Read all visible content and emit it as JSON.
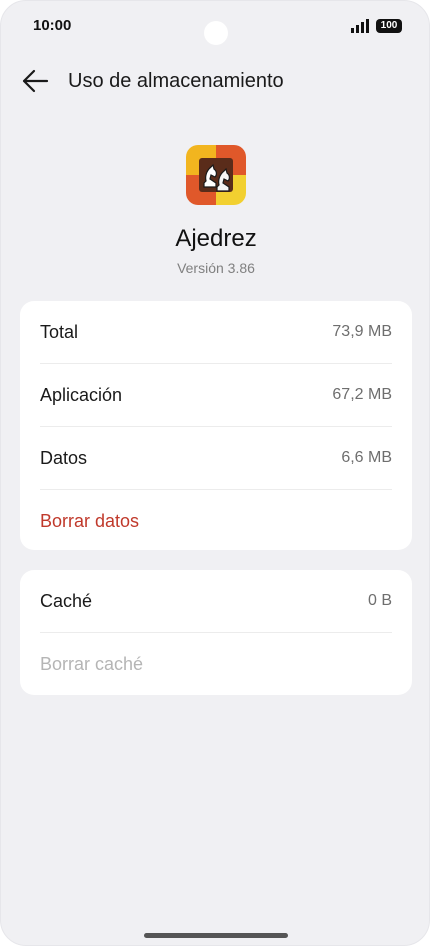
{
  "status_bar": {
    "time": "10:00",
    "battery": "100"
  },
  "header": {
    "title": "Uso de almacenamiento"
  },
  "app": {
    "name": "Ajedrez",
    "version": "Versión 3.86"
  },
  "storage": {
    "rows": [
      {
        "label": "Total",
        "value": "73,9 MB"
      },
      {
        "label": "Aplicación",
        "value": "67,2 MB"
      },
      {
        "label": "Datos",
        "value": "6,6 MB"
      }
    ],
    "clear_data_label": "Borrar datos"
  },
  "cache": {
    "label": "Caché",
    "value": "0 B",
    "clear_cache_label": "Borrar caché"
  },
  "colors": {
    "accent_red": "#c0392b",
    "disabled_text": "#b5b5b5",
    "background": "#f0f0f3"
  }
}
